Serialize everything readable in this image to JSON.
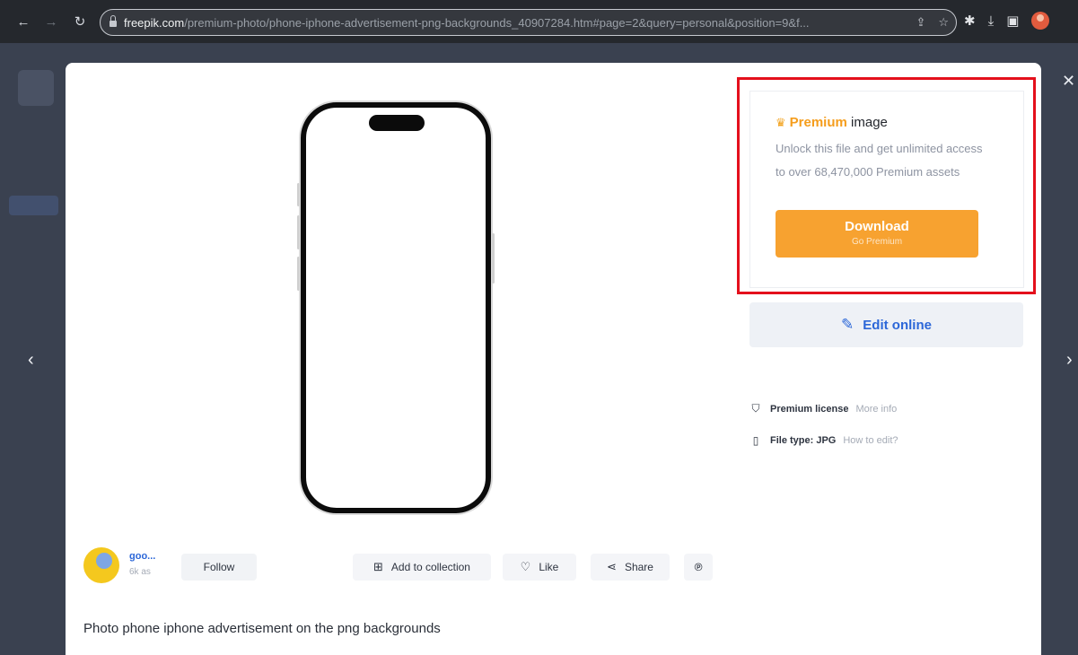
{
  "browser": {
    "url_host": "freepik.com",
    "url_path": "/premium-photo/phone-iphone-advertisement-png-backgrounds_40907284.htm#page=2&query=personal&position=9&f..."
  },
  "premium": {
    "word": "Premium",
    "word_suffix": " image",
    "description": "Unlock this file and get unlimited access to over 68,470,000 Premium assets",
    "download_label": "Download",
    "download_sub": "Go Premium"
  },
  "edit_online": {
    "label": "Edit online"
  },
  "license": {
    "label": "Premium license",
    "link": "More info"
  },
  "file_type": {
    "label": "File type: JPG",
    "link": "How to edit?"
  },
  "author": {
    "name": "goo...",
    "sub": "6k as",
    "follow_label": "Follow"
  },
  "actions": {
    "add_to_collection": "Add to collection",
    "like": "Like",
    "share": "Share"
  },
  "caption": "Photo phone iphone advertisement on the png backgrounds",
  "colors": {
    "premium_orange": "#f7a230",
    "highlight_red": "#e4101c",
    "link_blue": "#2c67d8"
  }
}
